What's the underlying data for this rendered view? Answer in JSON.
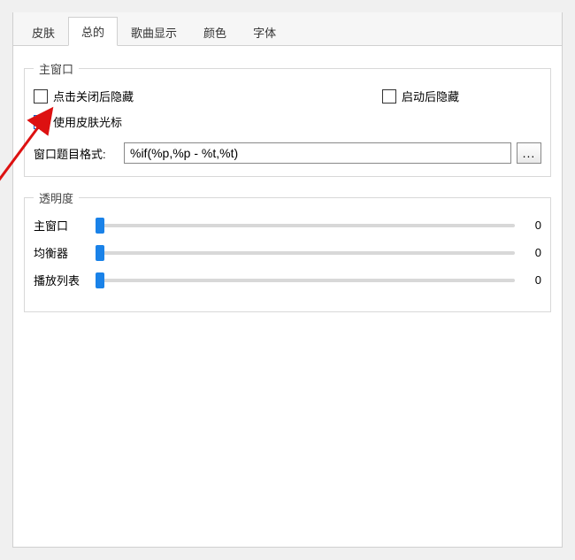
{
  "tabs": {
    "skin": "皮肤",
    "general": "总的",
    "songDisplay": "歌曲显示",
    "color": "颜色",
    "font": "字体"
  },
  "mainWindowGroup": {
    "legend": "主窗口",
    "hideOnClose": "点击关闭后隐藏",
    "hideOnStartup": "启动后隐藏",
    "useSkinCursor": "使用皮肤光标",
    "titleFormatLabel": "窗口题目格式:",
    "titleFormatValue": "%if(%p,%p - %t,%t)",
    "browseBtn": "..."
  },
  "transparencyGroup": {
    "legend": "透明度",
    "sliders": [
      {
        "label": "主窗口",
        "value": "0"
      },
      {
        "label": "均衡器",
        "value": "0"
      },
      {
        "label": "播放列表",
        "value": "0"
      }
    ]
  }
}
